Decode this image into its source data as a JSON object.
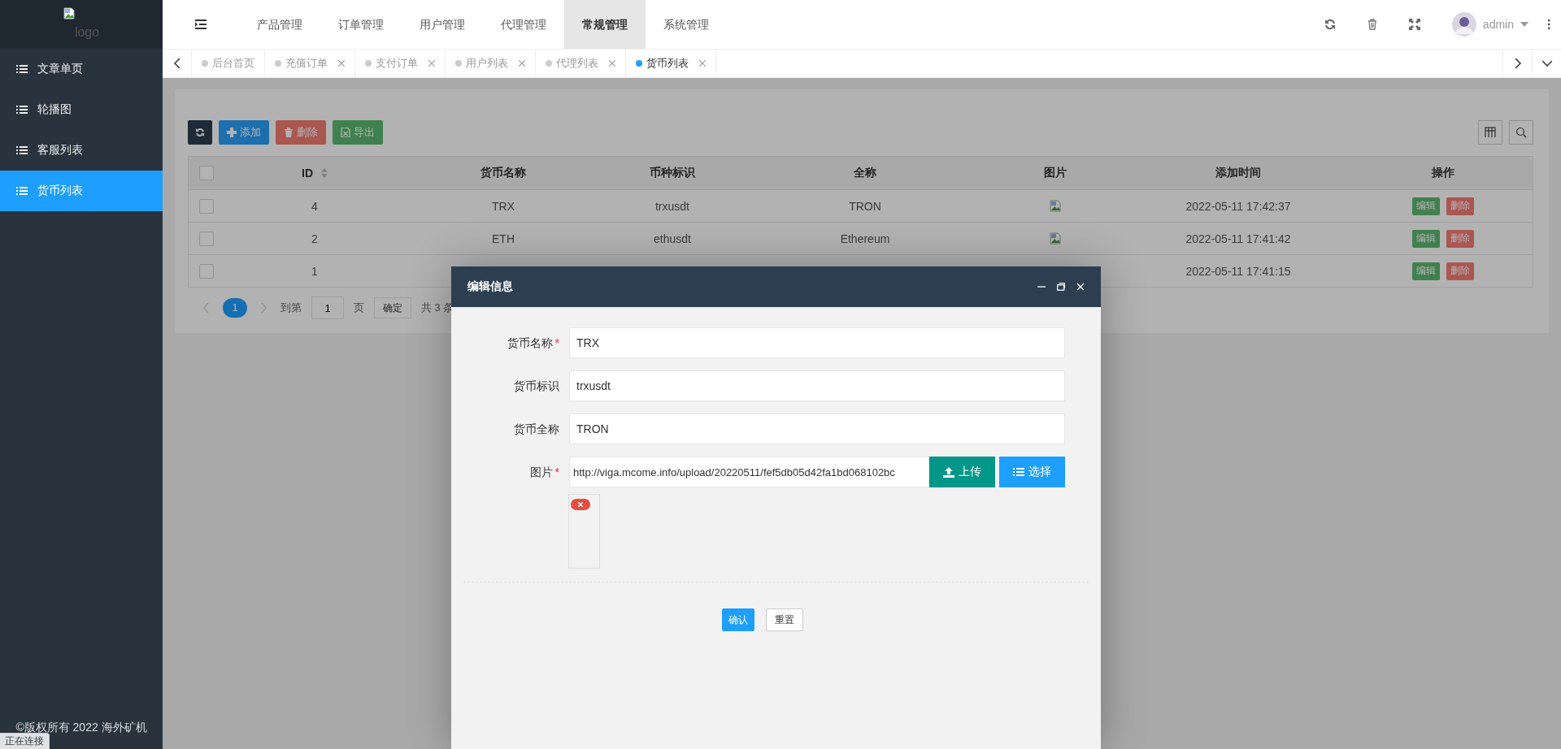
{
  "sidebar": {
    "logo": {
      "alt": "logo"
    },
    "items": [
      {
        "label": "文章单页",
        "selected": false
      },
      {
        "label": "轮播图",
        "selected": false
      },
      {
        "label": "客服列表",
        "selected": false
      },
      {
        "label": "货币列表",
        "selected": true
      }
    ],
    "copyright": "©版权所有 2022 海外矿机"
  },
  "header": {
    "menu": [
      {
        "label": "产品管理",
        "selected": false
      },
      {
        "label": "订单管理",
        "selected": false
      },
      {
        "label": "用户管理",
        "selected": false
      },
      {
        "label": "代理管理",
        "selected": false
      },
      {
        "label": "常规管理",
        "selected": true
      },
      {
        "label": "系统管理",
        "selected": false
      }
    ],
    "user": {
      "name": "admin"
    }
  },
  "tabs": [
    {
      "label": "后台首页",
      "closable": false,
      "selected": false
    },
    {
      "label": "充值订单",
      "closable": true,
      "selected": false
    },
    {
      "label": "支付订单",
      "closable": true,
      "selected": false
    },
    {
      "label": "用户列表",
      "closable": true,
      "selected": false
    },
    {
      "label": "代理列表",
      "closable": true,
      "selected": false
    },
    {
      "label": "货币列表",
      "closable": true,
      "selected": true
    }
  ],
  "toolbar": [
    {
      "kind": "refresh"
    },
    {
      "kind": "add",
      "label": "添加"
    },
    {
      "kind": "delete",
      "label": "删除"
    },
    {
      "kind": "export",
      "label": "导出"
    }
  ],
  "table": {
    "all_checked": false,
    "columns": [
      {
        "label": "ID",
        "sortable": true
      },
      {
        "label": "货币名称",
        "sortable": false
      },
      {
        "label": "币种标识",
        "sortable": false
      },
      {
        "label": "全称",
        "sortable": false
      },
      {
        "label": "图片",
        "sortable": false
      },
      {
        "label": "添加时间",
        "sortable": false
      },
      {
        "label": "操作",
        "sortable": false
      }
    ],
    "rows": [
      {
        "checked": false,
        "id": "4",
        "name": "TRX",
        "symbol": "trxusdt",
        "full_name": "TRON",
        "has_image": true,
        "time": "2022-05-11 17:42:37",
        "actions": [
          "编辑",
          "删除"
        ]
      },
      {
        "checked": false,
        "id": "2",
        "name": "ETH",
        "symbol": "ethusdt",
        "full_name": "Ethereum",
        "has_image": true,
        "time": "2022-05-11 17:41:42",
        "actions": [
          "编辑",
          "删除"
        ]
      },
      {
        "checked": false,
        "id": "1",
        "time": "2022-05-11 17:41:15",
        "actions": [
          "编辑",
          "删除"
        ]
      }
    ]
  },
  "pagination": {
    "current": "1",
    "goto_label": "到第",
    "page_input": "1",
    "page_suffix": "页",
    "confirm": "确定",
    "total": "共 3 条"
  },
  "modal": {
    "title": "编辑信息",
    "fields": [
      {
        "kind": "text",
        "label": "货币名称",
        "required_mark": "*",
        "value": "TRX"
      },
      {
        "kind": "text",
        "label": "货币标识",
        "value": "trxusdt"
      },
      {
        "kind": "text",
        "label": "货币全称",
        "value": "TRON"
      },
      {
        "kind": "upload",
        "label": "图片",
        "required_mark": "*",
        "value": "http://viga.mcome.info/upload/20220511/fef5db05d42fa1bd068102bc",
        "buttons": [
          {
            "kind": "upload",
            "label": "上传"
          },
          {
            "kind": "choose",
            "label": "选择"
          }
        ]
      }
    ],
    "buttons": [
      {
        "kind": "primary",
        "label": "确认"
      },
      {
        "kind": "plain",
        "label": "重置"
      }
    ]
  },
  "status_bubble": "正在连接"
}
